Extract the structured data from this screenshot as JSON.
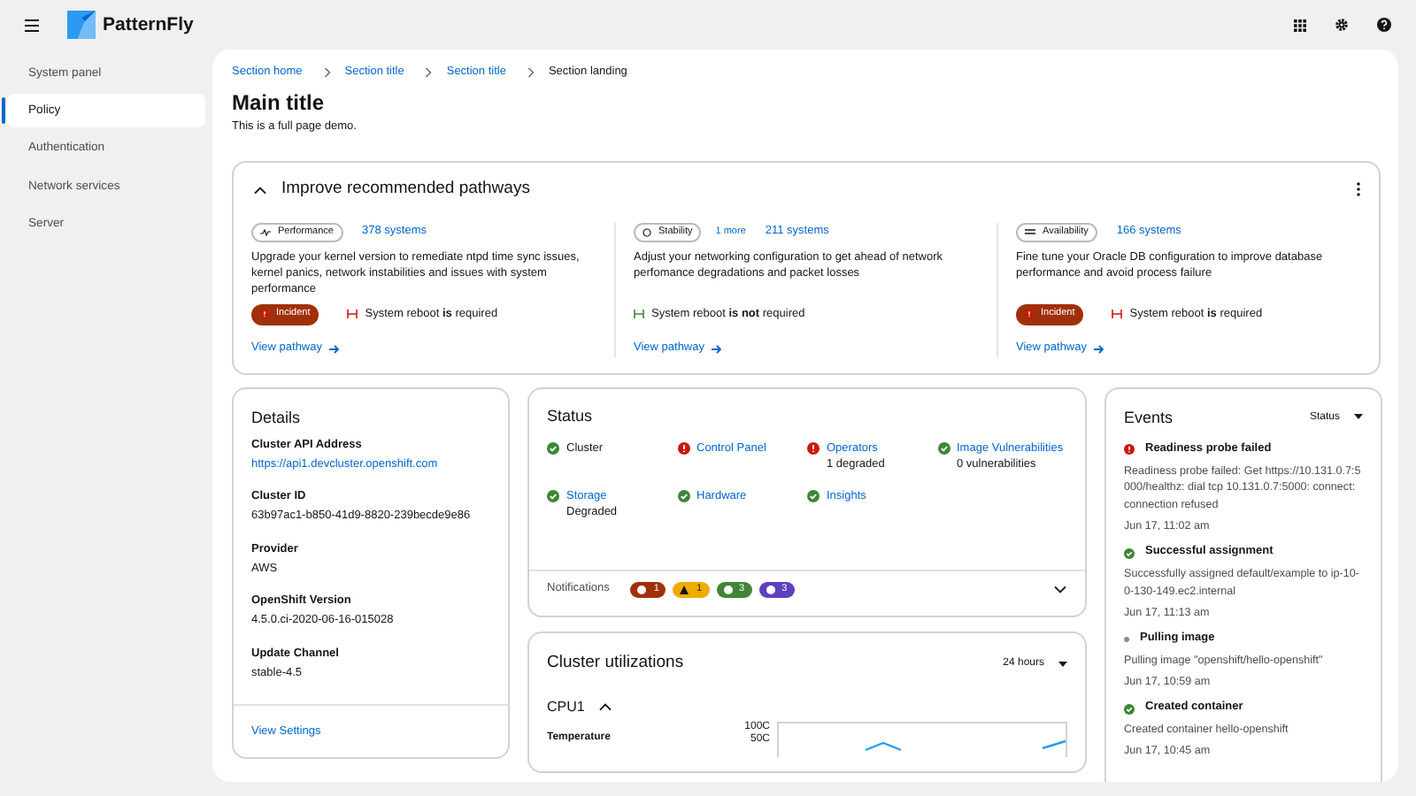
{
  "header": {
    "brand": "PatternFly"
  },
  "sidebar": {
    "items": [
      {
        "label": "System panel",
        "selected": false
      },
      {
        "label": "Policy",
        "selected": true
      },
      {
        "label": "Authentication",
        "selected": false
      },
      {
        "label": "Network services",
        "selected": false
      },
      {
        "label": "Server",
        "selected": false
      }
    ]
  },
  "breadcrumb": [
    "Section home",
    "Section title",
    "Section title",
    "Section landing"
  ],
  "page": {
    "title": "Main title",
    "description": "This is a full page demo."
  },
  "pathways": {
    "title": "Improve recommended pathways",
    "expanded": true,
    "items": [
      {
        "category": "Performance",
        "systems": "378 systems",
        "description": "Upgrade your kernel version to remediate ntpd time sync issues, kernel panics, network instabilities and issues with system performance",
        "incident": "Incident",
        "reboot_required": true,
        "reboot_text": "System reboot **is** required",
        "link": "View pathway"
      },
      {
        "category": "Stability",
        "more": "1 more",
        "systems": "211 systems",
        "description": "Adjust your networking configuration to get ahead of network perfomance degradations and packet losses",
        "reboot_required": false,
        "reboot_text": "System reboot **is not** required",
        "link": "View pathway"
      },
      {
        "category": "Availability",
        "systems": "166 systems",
        "description": "Fine tune your Oracle DB configuration to improve database performance and avoid process failure",
        "incident": "Incident",
        "reboot_required": true,
        "reboot_text": "System reboot **is** required",
        "link": "View pathway"
      }
    ]
  },
  "details": {
    "title": "Details",
    "fields": [
      {
        "label": "Cluster API Address",
        "value": "https://api1.devcluster.openshift.com",
        "kind": "link"
      },
      {
        "label": "Cluster ID",
        "value": "63b97ac1-b850-41d9-8820-239becde9e86",
        "kind": "text"
      },
      {
        "label": "Provider",
        "value": "AWS",
        "kind": "text"
      },
      {
        "label": "OpenShift Version",
        "value": "4.5.0.ci-2020-06-16-015028",
        "kind": "text"
      },
      {
        "label": "Update Channel",
        "value": "stable-4.5",
        "kind": "text"
      }
    ],
    "footer_link": "View Settings"
  },
  "status": {
    "title": "Status",
    "items": [
      {
        "name": "Cluster",
        "kind": "ok",
        "link": false
      },
      {
        "name": "Control Panel",
        "kind": "danger",
        "link": true
      },
      {
        "name": "Operators",
        "kind": "danger",
        "link": true,
        "detail": "1 degraded"
      },
      {
        "name": "Image Vulnerabilities",
        "kind": "ok",
        "link": true,
        "detail": "0 vulnerabilities"
      },
      {
        "name": "Storage",
        "kind": "ok",
        "link": true,
        "detail": "Degraded"
      },
      {
        "name": "Hardware",
        "kind": "ok",
        "link": true
      },
      {
        "name": "Insights",
        "kind": "ok",
        "link": true
      }
    ],
    "notifications": {
      "label": "Notifications",
      "expanded": false,
      "badges": [
        {
          "count": "1",
          "kind": "danger"
        },
        {
          "count": "1",
          "kind": "warning"
        },
        {
          "count": "3",
          "kind": "success"
        },
        {
          "count": "3",
          "kind": "info"
        }
      ]
    }
  },
  "utilization": {
    "title": "Cluster utilizations",
    "range": "24 hours",
    "section": "CPU1",
    "expanded": true,
    "metric": "Temperature",
    "ticks": [
      "100C",
      "50C"
    ]
  },
  "events": {
    "title": "Events",
    "filter": "Status",
    "items": [
      {
        "title": "Readiness probe failed",
        "kind": "danger",
        "message": "Readiness probe failed: Get https://10.131.0.7:5000/healthz: dial tcp 10.131.0.7:5000: connect: connection refused",
        "time": "Jun 17, 11:02 am"
      },
      {
        "title": "Successful assignment",
        "kind": "ok",
        "message": "Successfully assigned default/example to ip-10-0-130-149.ec2.internal",
        "time": "Jun 17, 11:13 am"
      },
      {
        "title": "Pulling image",
        "kind": "pending",
        "message": "Pulling image \"openshift/hello-openshift\"",
        "time": "Jun 17, 10:59 am"
      },
      {
        "title": "Created container",
        "kind": "ok",
        "message": "Created container hello-openshift",
        "time": "Jun 17, 10:45 am"
      }
    ]
  }
}
